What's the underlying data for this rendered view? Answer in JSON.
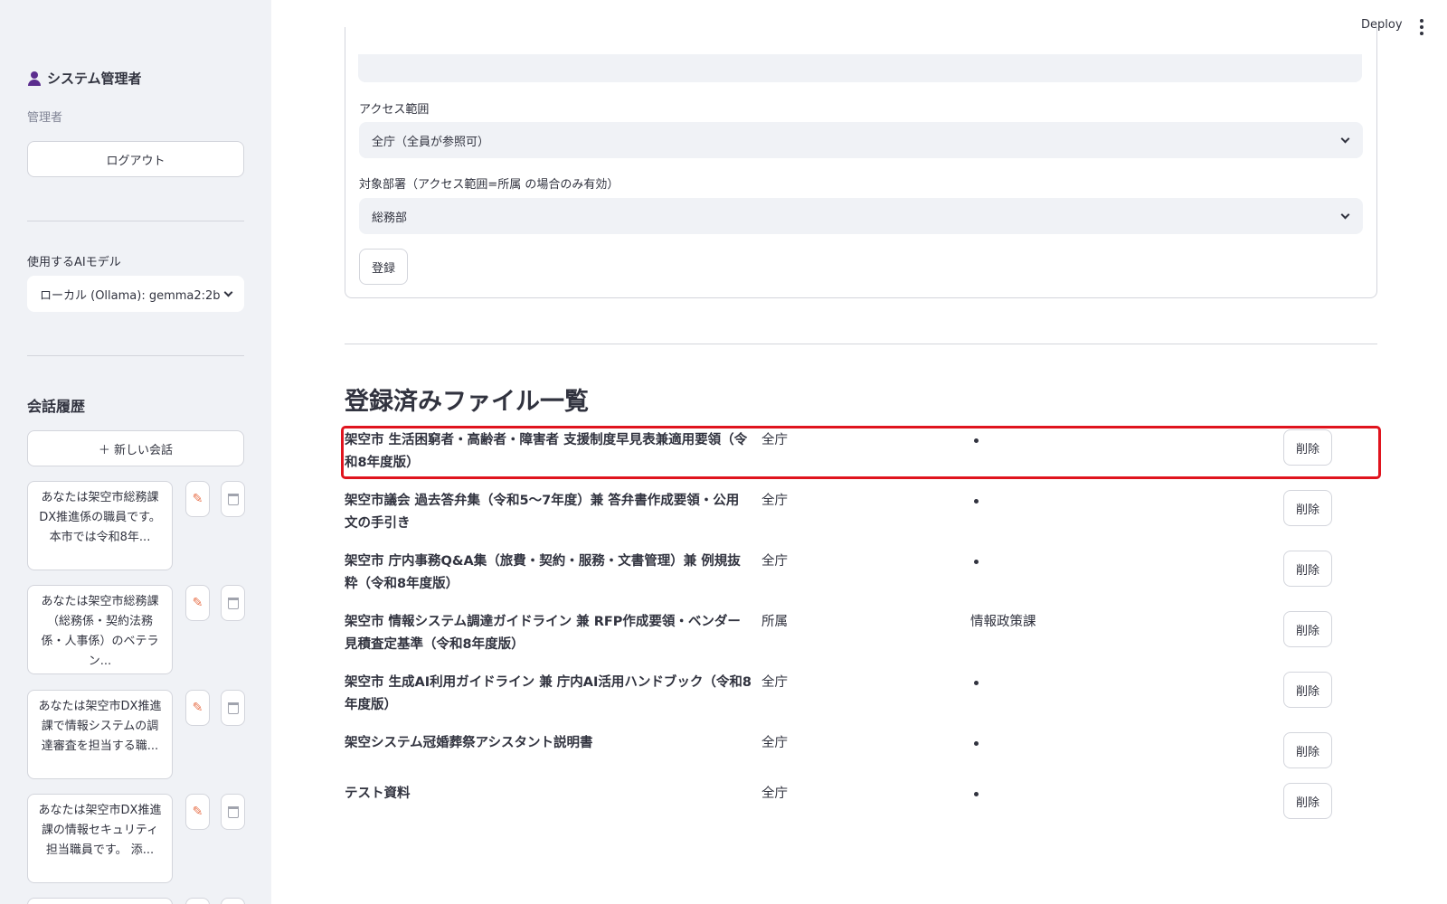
{
  "sidebar": {
    "user_name": "システム管理者",
    "user_role": "管理者",
    "logout_label": "ログアウト",
    "model_label": "使用するAIモデル",
    "model_value": "ローカル (Ollama): gemma2:2b",
    "history_title": "会話履歴",
    "new_chat_label": "＋ 新しい会話",
    "conversations": [
      "あなたは架空市総務課DX推進係の職員です。 本市では令和8年...",
      "あなたは架空市総務課（総務係・契約法務係・人事係）のベテラン...",
      "あなたは架空市DX推進課で情報システムの調達審査を担当する職...",
      "あなたは架空市DX推進課の情報セキュリティ担当職員です。 添..."
    ]
  },
  "header": {
    "deploy_label": "Deploy"
  },
  "form": {
    "access_label": "アクセス範囲",
    "access_value": "全庁（全員が参照可）",
    "dept_label": "対象部署（アクセス範囲=所属 の場合のみ有効）",
    "dept_value": "総務部",
    "register_label": "登録"
  },
  "file_list": {
    "title": "登録済みファイル一覧",
    "delete_label": "削除",
    "rows": [
      {
        "name": "架空市 生活困窮者・高齢者・障害者 支援制度早見表兼適用要領（令和8年度版）",
        "scope": "全庁",
        "dept": "",
        "highlighted": true
      },
      {
        "name": "架空市議会 過去答弁集（令和5〜7年度）兼 答弁書作成要領・公用文の手引き",
        "scope": "全庁",
        "dept": ""
      },
      {
        "name": "架空市 庁内事務Q&A集（旅費・契約・服務・文書管理）兼 例規抜粋（令和8年度版）",
        "scope": "全庁",
        "dept": ""
      },
      {
        "name": "架空市 情報システム調達ガイドライン 兼 RFP作成要領・ベンダー見積査定基準（令和8年度版）",
        "scope": "所属",
        "dept": "情報政策課"
      },
      {
        "name": "架空市 生成AI利用ガイドライン 兼 庁内AI活用ハンドブック（令和8年度版）",
        "scope": "全庁",
        "dept": ""
      },
      {
        "name": "架空システム冠婚葬祭アシスタント説明書",
        "scope": "全庁",
        "dept": ""
      },
      {
        "name": "テスト資料",
        "scope": "全庁",
        "dept": ""
      }
    ]
  },
  "colors": {
    "sidebar_bg": "#f0f2f6",
    "highlight": "#e0141e",
    "user_icon": "#5b2d8e",
    "edit_icon": "#e8744f"
  }
}
